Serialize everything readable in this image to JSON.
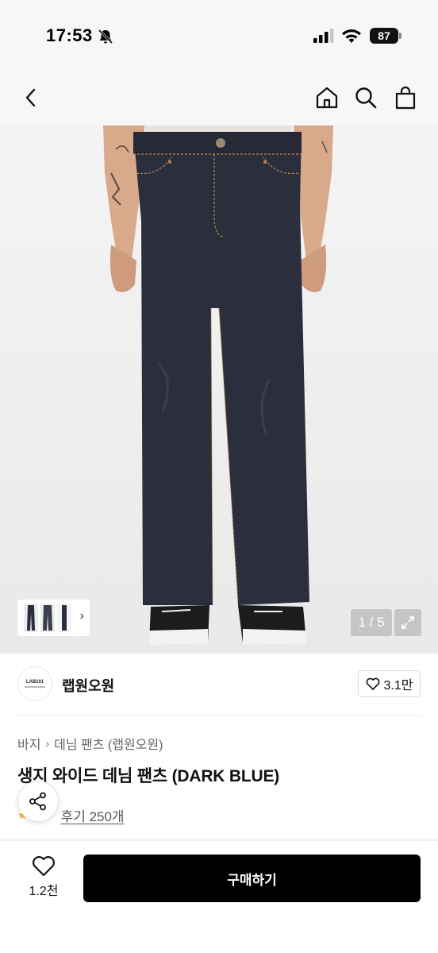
{
  "status_bar": {
    "time": "17:53",
    "battery": "87",
    "icons": [
      "bell-off-icon",
      "signal-icon",
      "wifi-icon",
      "battery-icon"
    ]
  },
  "nav": {
    "icons": [
      "back-chevron-icon",
      "home-icon",
      "search-icon",
      "shopping-bag-icon"
    ]
  },
  "gallery": {
    "page_indicator": "1 / 5",
    "thumbnail_count": 3,
    "icons": [
      "chevron-right-icon",
      "expand-icon"
    ]
  },
  "brand": {
    "logo_text": "LAB101",
    "name": "랩원오원",
    "like_count": "3.1만"
  },
  "product": {
    "breadcrumb": [
      "바지",
      "데님 팬츠 (랩원오원)"
    ],
    "title": "생지 와이드 데님 팬츠 (DARK BLUE)",
    "review_link": "후기 250개"
  },
  "bottom_bar": {
    "wish_count": "1.2천",
    "buy_label": "구매하기"
  },
  "colors": {
    "accent": "#000000",
    "denim": "#2b2f3d",
    "stitch": "#b8864a",
    "star": "#f2a31b"
  }
}
